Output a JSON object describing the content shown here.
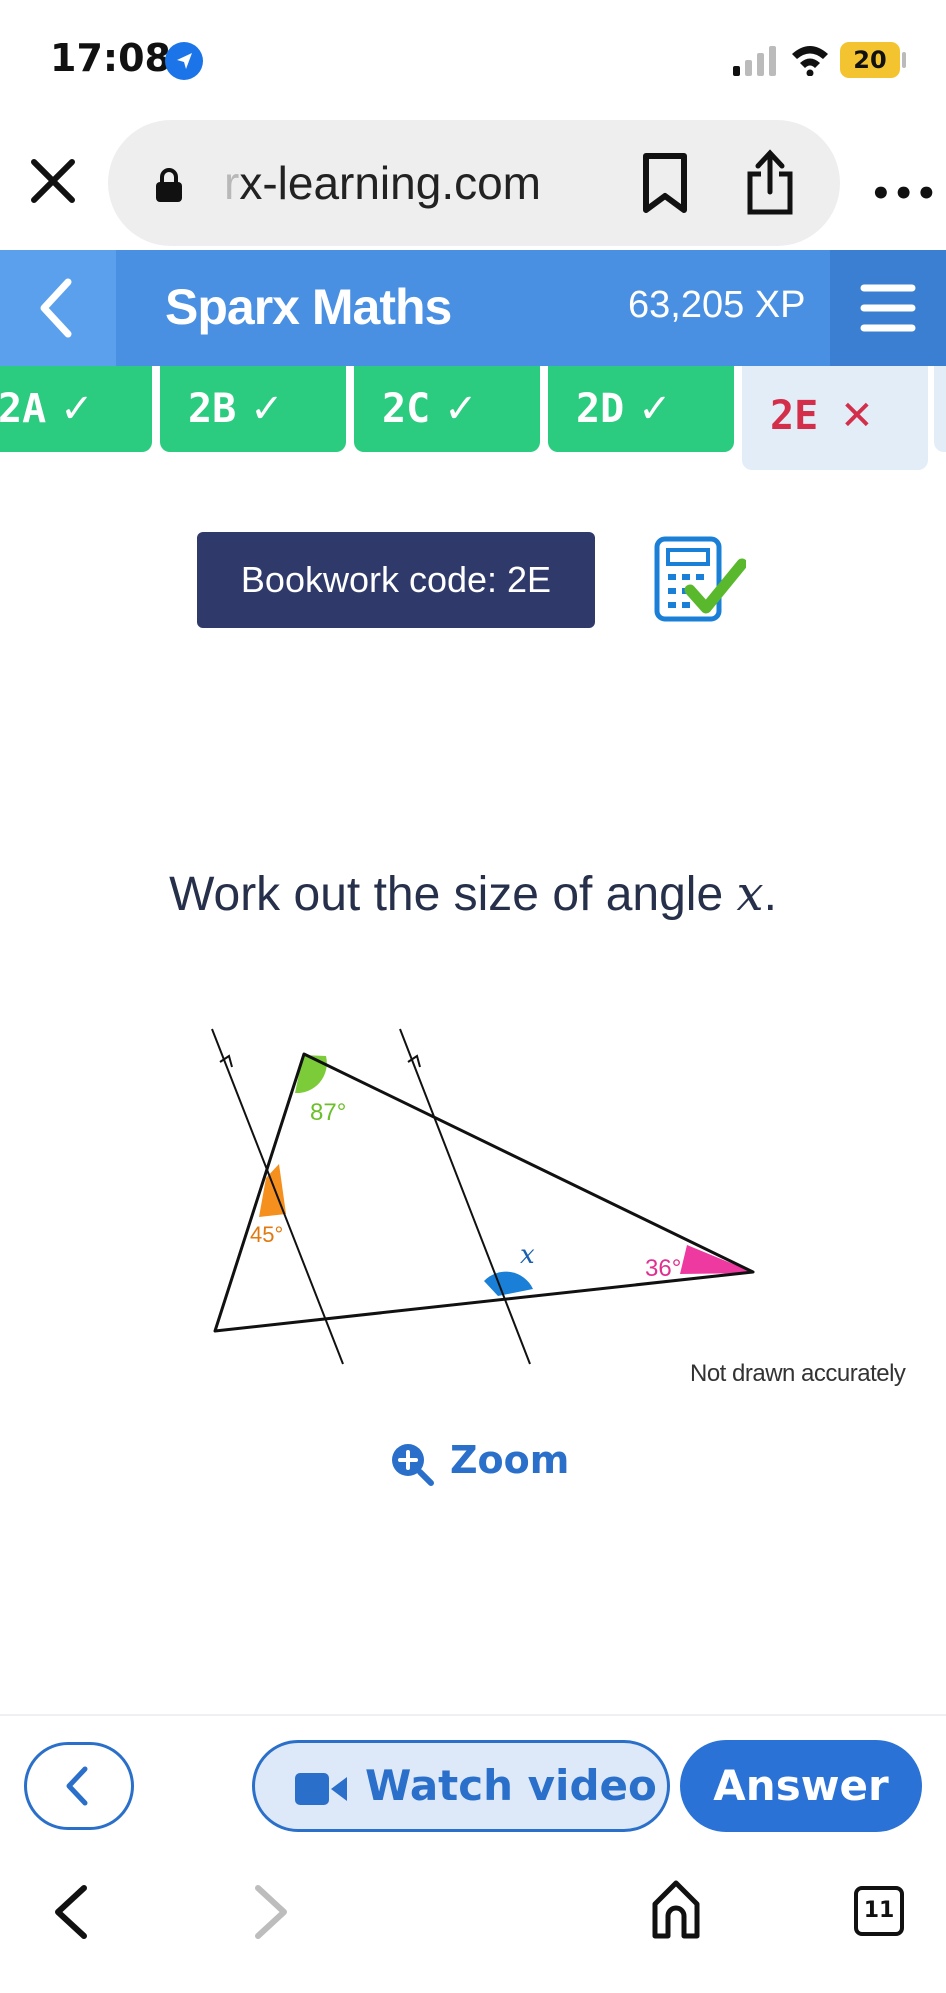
{
  "status_bar": {
    "time": "17:08",
    "battery": "20"
  },
  "browser": {
    "url_hidden": "r",
    "url": "x-learning.com",
    "more": "•••"
  },
  "header": {
    "brand": "Sparx Maths",
    "xp": "63,205 XP"
  },
  "tabs": [
    {
      "label": "2A",
      "status": "done"
    },
    {
      "label": "2B",
      "status": "done"
    },
    {
      "label": "2C",
      "status": "done"
    },
    {
      "label": "2D",
      "status": "done"
    },
    {
      "label": "2E",
      "status": "incorrect"
    }
  ],
  "tab_marks": {
    "done": "✓",
    "incorrect": "✕"
  },
  "bookwork": {
    "label": "Bookwork code: 2E"
  },
  "question": {
    "text": "Work out the size of angle",
    "variable": "x",
    "end": "."
  },
  "diagram": {
    "angle_top": "87°",
    "angle_left": "45°",
    "angle_right": "36°",
    "angle_unknown": "x",
    "note": "Not drawn accurately"
  },
  "zoom": {
    "label": "Zoom"
  },
  "actions": {
    "watch_video": "Watch video",
    "answer": "Answer"
  },
  "browser_nav": {
    "tab_count": "11"
  },
  "colors": {
    "green": "#7ccc3a",
    "orange": "#f5901e",
    "pink": "#ee3aa0",
    "blue": "#1a7fd6"
  }
}
